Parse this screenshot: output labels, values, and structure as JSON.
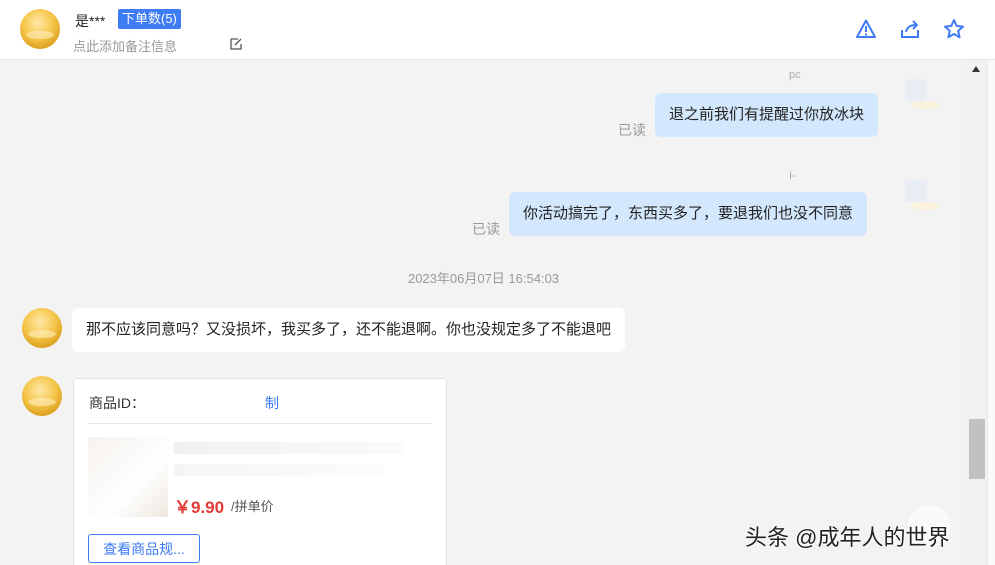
{
  "header": {
    "contact_name": "是***",
    "order_badge": "下单数(5)",
    "remark_placeholder": "点此添加备注信息",
    "icons": [
      "warning-icon",
      "share-icon",
      "star-icon"
    ]
  },
  "messages": {
    "sent_1": {
      "top_label": "pc",
      "text": "退之前我们有提醒过你放冰块",
      "status": "已读"
    },
    "sent_2": {
      "top_label": "I-",
      "text": "你活动搞完了，东西买多了，要退我们也没不同意",
      "status": "已读"
    },
    "timestamp": "2023年06月07日 16:54:03",
    "received_1": {
      "text": "那不应该同意吗？又没损坏，我买多了，还不能退啊。你也没规定多了不能退吧"
    }
  },
  "product_card": {
    "id_label": "商品ID：",
    "id_value": "制",
    "price": "￥9.90",
    "price_unit": "/拼单价",
    "spec_button": "查看商品规..."
  },
  "watermark": "头条 @成年人的世界",
  "colors": {
    "accent": "#3d7cf5",
    "sent_bubble": "#d3e8fd",
    "price": "#e53935"
  }
}
